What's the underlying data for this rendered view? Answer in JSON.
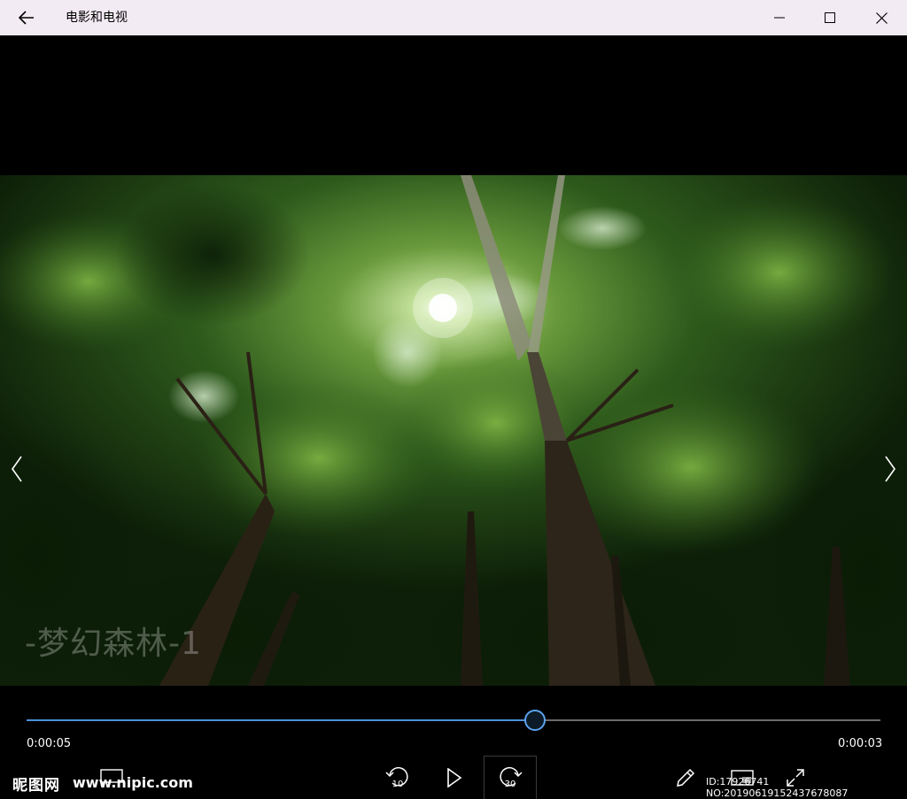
{
  "window": {
    "title": "电影和电视",
    "back_icon": "back-arrow-icon",
    "minimize_icon": "minimize-icon",
    "maximize_icon": "maximize-icon",
    "close_icon": "close-icon"
  },
  "video": {
    "caption": "-梦幻森林-1",
    "prev_icon": "chevron-left-icon",
    "next_icon": "chevron-right-icon"
  },
  "player": {
    "elapsed": "0:00:05",
    "remaining": "0:00:03",
    "progress": 0.595,
    "rewind_label": "10",
    "forward_label": "30",
    "accent_color": "#4a90d9"
  },
  "watermark": {
    "logo": "昵图网",
    "url": "www.nipic.com",
    "id_text": "ID:17926741 NO:20190619152437678087"
  }
}
